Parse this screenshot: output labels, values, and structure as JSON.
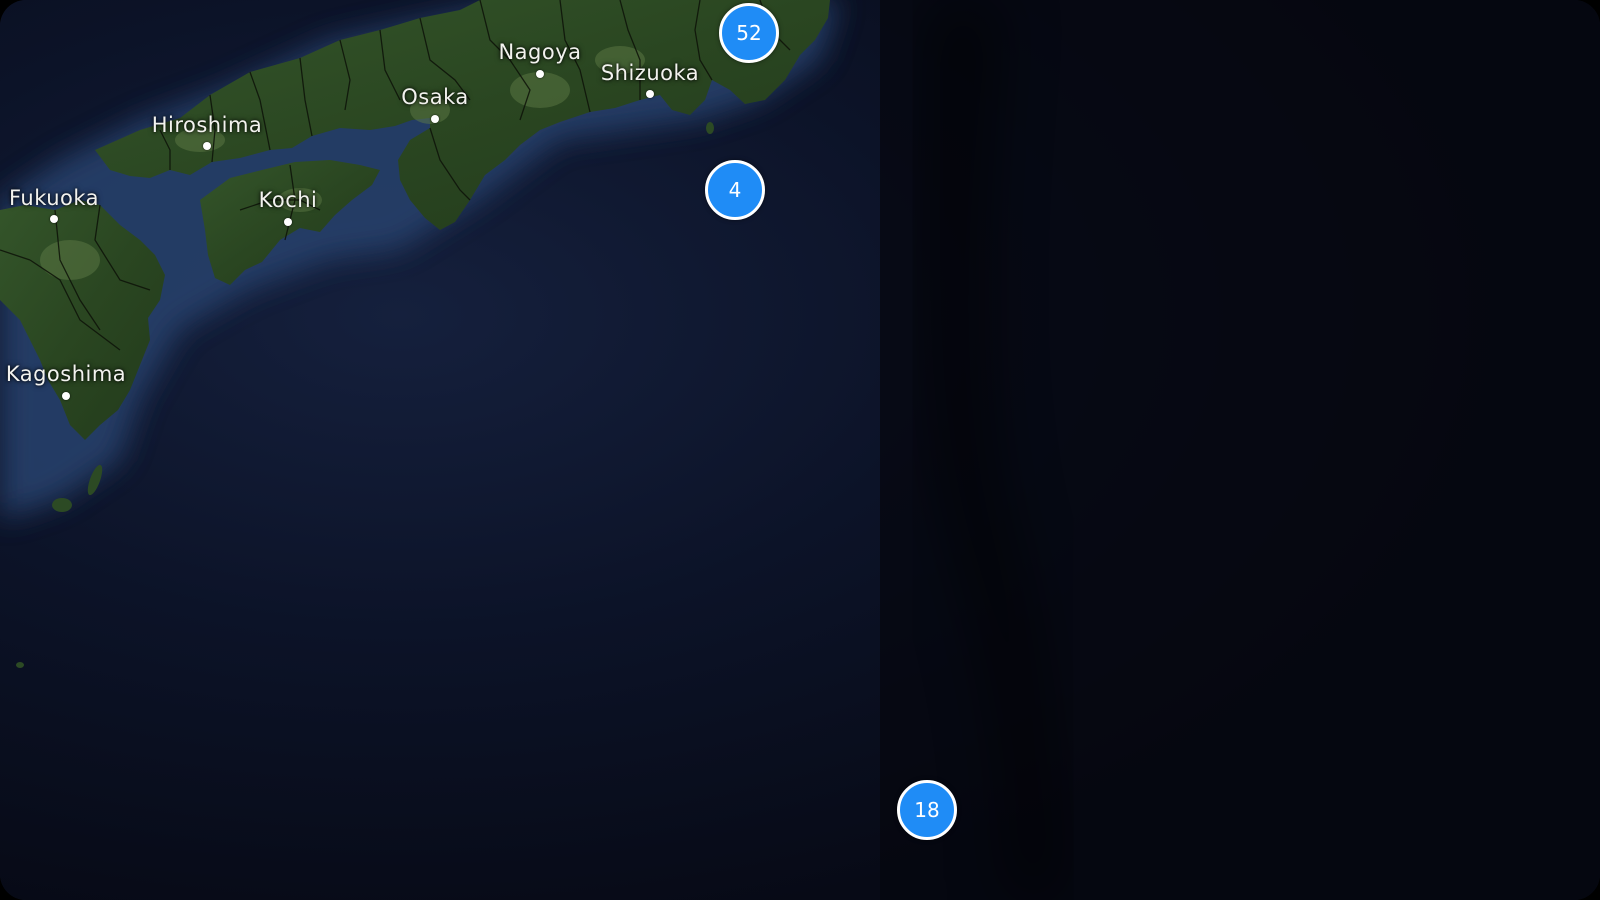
{
  "map": {
    "style": "satellite",
    "colors": {
      "cluster_fill": "#1f8cf6",
      "cluster_border": "#ffffff",
      "ocean_dark": "#05070f",
      "ocean_mid": "#0b1124",
      "land": "#2c4a24"
    },
    "cities": [
      {
        "name": "Nagoya"
      },
      {
        "name": "Shizuoka"
      },
      {
        "name": "Osaka"
      },
      {
        "name": "Hiroshima"
      },
      {
        "name": "Kochi"
      },
      {
        "name": "Fukuoka"
      },
      {
        "name": "Kagoshima"
      }
    ],
    "clusters": [
      {
        "count": "52"
      },
      {
        "count": "4"
      },
      {
        "count": "18"
      }
    ]
  }
}
